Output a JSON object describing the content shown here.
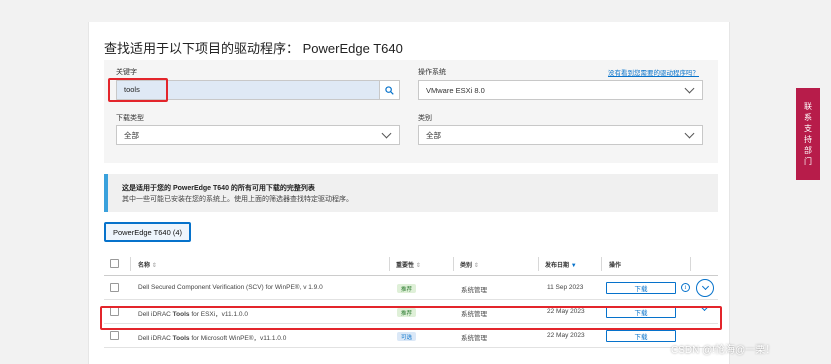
{
  "page": {
    "title": "查找适用于以下项目的驱动程序：  PowerEdge T640"
  },
  "filters": {
    "keyword_label": "关键字",
    "keyword_value": "tools",
    "os_label": "操作系统",
    "os_value": "VMware ESXi 8.0",
    "os_link": "没有看到您需要的驱动程序吗？",
    "download_type_label": "下载类型",
    "download_type_value": "全部",
    "category_label": "类别",
    "category_value": "全部"
  },
  "banner": {
    "title": "这是适用于您的 PowerEdge T640 的所有可用下载的完整列表",
    "desc": "其中一些可能已安装在您的系统上。使用上面的筛选器查找特定驱动程序。"
  },
  "product_pill": "PowerEdge T640 (4)",
  "table": {
    "headers": {
      "name": "名称",
      "importance": "重要性",
      "category": "类别",
      "release_date": "发布日期",
      "action": "操作"
    },
    "rows": [
      {
        "name_prefix": "Dell Secured Component Verification (SCV) for WinPE®, v 1.9.0",
        "name_bold": "",
        "name_suffix": "",
        "importance": "推荐",
        "category": "系统管理",
        "date": "11 Sep 2023",
        "action": "下载"
      },
      {
        "name_prefix": "Dell iDRAC ",
        "name_bold": "Tools",
        "name_suffix": " for ESXi，v11.1.0.0",
        "importance": "推荐",
        "category": "系统管理",
        "date": "22 May 2023",
        "action": "下载"
      },
      {
        "name_prefix": "Dell iDRAC ",
        "name_bold": "Tools",
        "name_suffix": " for Microsoft WinPE®，v11.1.0.0",
        "importance": "可选",
        "category": "系统管理",
        "date": "22 May 2023",
        "action": "下载"
      }
    ]
  },
  "contact_tab": [
    "联",
    "系",
    "支",
    "持",
    "部",
    "门"
  ],
  "watermark": "CSDN @!怆海@一栗！",
  "colors": {
    "accent": "#0672cb",
    "highlight": "#e3252b",
    "contact_tab": "#b71c4a",
    "banner_bar": "#3aa1dc",
    "badge_recommended_bg": "#dff0d8",
    "badge_recommended_fg": "#2e7d32",
    "badge_optional_bg": "#dbe8f7",
    "badge_optional_fg": "#0672cb"
  },
  "icons": [
    "search-icon",
    "chevron-down-icon",
    "info-icon",
    "expand-chevron-icon",
    "sort-icon"
  ]
}
